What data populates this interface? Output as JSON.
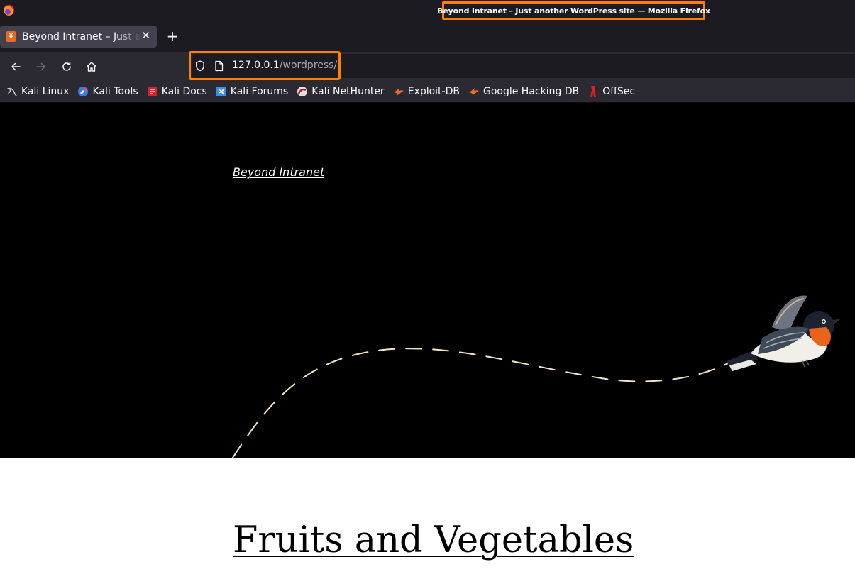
{
  "window": {
    "title": "Beyond Intranet – Just another WordPress site — Mozilla Firefox"
  },
  "tab": {
    "label": "Beyond Intranet – Just another WordPress site",
    "favicon_text": "⌘"
  },
  "url": {
    "host": "127.0.0.1",
    "path": "/wordpress/"
  },
  "bookmarks": [
    {
      "label": "Kali Linux",
      "icon": "kali-dragon-icon"
    },
    {
      "label": "Kali Tools",
      "icon": "kali-tools-icon"
    },
    {
      "label": "Kali Docs",
      "icon": "kali-docs-icon"
    },
    {
      "label": "Kali Forums",
      "icon": "kali-forums-icon"
    },
    {
      "label": "Kali NetHunter",
      "icon": "kali-nethunter-icon"
    },
    {
      "label": "Exploit-DB",
      "icon": "exploit-db-icon"
    },
    {
      "label": "Google Hacking DB",
      "icon": "ghdb-icon"
    },
    {
      "label": "OffSec",
      "icon": "offsec-icon"
    }
  ],
  "page": {
    "site_title": "Beyond Intranet",
    "post_title": "Fruits and Vegetables"
  },
  "colors": {
    "highlight": "#ff7f00",
    "hero_bg": "#000000",
    "dash_line": "#f3e6c8"
  }
}
